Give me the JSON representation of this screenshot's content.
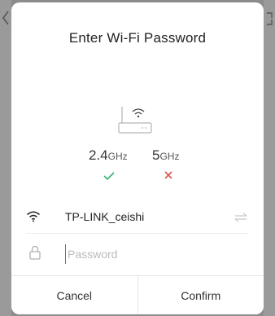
{
  "dialog": {
    "title": "Enter Wi-Fi Password"
  },
  "bands": [
    {
      "value": "2.4",
      "unit": "GHz",
      "supported": true
    },
    {
      "value": "5",
      "unit": "GHz",
      "supported": false
    }
  ],
  "network": {
    "ssid": "TP-LINK_ceishi"
  },
  "password": {
    "placeholder": "Password",
    "value": ""
  },
  "footer": {
    "cancel_label": "Cancel",
    "confirm_label": "Confirm"
  },
  "colors": {
    "check": "#35b36b",
    "cross": "#e0514a",
    "cursor": "#3a7bd5",
    "overlay": "#8c8c8c"
  },
  "icons": [
    "back-chevron-icon",
    "router-wifi-icon",
    "check-icon",
    "cross-icon",
    "wifi-icon",
    "switch-network-icon",
    "lock-icon"
  ]
}
